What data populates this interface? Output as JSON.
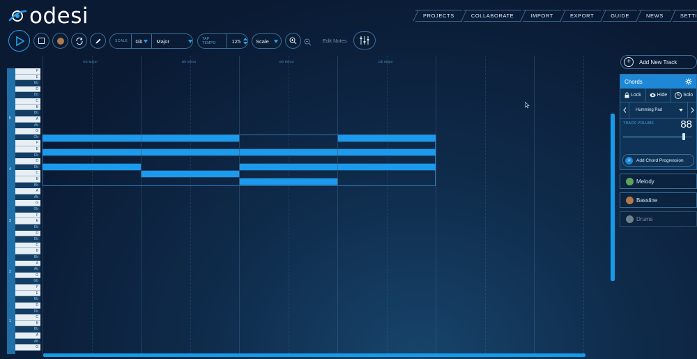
{
  "app": {
    "logo_text": "odesi"
  },
  "nav": [
    "PROJECTS",
    "COLLABORATE",
    "IMPORT",
    "EXPORT",
    "GUIDE",
    "NEWS",
    "SETTINGS"
  ],
  "toolbar": {
    "scale_label": "SCALE",
    "scale_key": "Gb",
    "scale_mode": "Major",
    "tap_tempo_label": "TAP TEMPO",
    "tempo": "125",
    "snap": "Scale",
    "edit_notes": "Edit Notes"
  },
  "chord_labels": [
    "Gb Major",
    "Bb Minor",
    "Eb Minor",
    "Db Major"
  ],
  "piano": {
    "octaves": [
      "5",
      "4",
      "3",
      "2",
      "1"
    ],
    "keys": [
      {
        "n": "F",
        "c": "w"
      },
      {
        "n": "E",
        "c": "w"
      },
      {
        "n": "Eb",
        "c": "b"
      },
      {
        "n": "D",
        "c": "w"
      },
      {
        "n": "Db",
        "c": "b"
      },
      {
        "n": "C",
        "c": "w"
      },
      {
        "n": "B",
        "c": "w"
      },
      {
        "n": "Bb",
        "c": "b"
      },
      {
        "n": "A",
        "c": "w"
      },
      {
        "n": "Ab",
        "c": "b"
      },
      {
        "n": "G",
        "c": "w"
      },
      {
        "n": "Gb",
        "c": "b"
      },
      {
        "n": "F",
        "c": "w"
      },
      {
        "n": "E",
        "c": "w"
      },
      {
        "n": "Eb",
        "c": "b"
      },
      {
        "n": "D",
        "c": "w"
      },
      {
        "n": "Db",
        "c": "b"
      },
      {
        "n": "C",
        "c": "w"
      },
      {
        "n": "B",
        "c": "w"
      },
      {
        "n": "Bb",
        "c": "b"
      },
      {
        "n": "A",
        "c": "w"
      },
      {
        "n": "Ab",
        "c": "b"
      },
      {
        "n": "G",
        "c": "w"
      },
      {
        "n": "Gb",
        "c": "b"
      },
      {
        "n": "F",
        "c": "w"
      },
      {
        "n": "E",
        "c": "w"
      },
      {
        "n": "Eb",
        "c": "b"
      },
      {
        "n": "D",
        "c": "w"
      },
      {
        "n": "Db",
        "c": "b"
      },
      {
        "n": "C",
        "c": "w"
      },
      {
        "n": "B",
        "c": "w"
      },
      {
        "n": "Bb",
        "c": "b"
      },
      {
        "n": "A",
        "c": "w"
      },
      {
        "n": "Ab",
        "c": "b"
      },
      {
        "n": "G",
        "c": "w"
      },
      {
        "n": "Gb",
        "c": "b"
      },
      {
        "n": "F",
        "c": "w"
      },
      {
        "n": "E",
        "c": "w"
      },
      {
        "n": "Eb",
        "c": "b"
      },
      {
        "n": "D",
        "c": "w"
      },
      {
        "n": "Db",
        "c": "b"
      },
      {
        "n": "C",
        "c": "w"
      },
      {
        "n": "B",
        "c": "w"
      },
      {
        "n": "Bb",
        "c": "b"
      },
      {
        "n": "A",
        "c": "w"
      },
      {
        "n": "Ab",
        "c": "b"
      },
      {
        "n": "G",
        "c": "w"
      }
    ]
  },
  "tracks_panel": {
    "add_track": "Add New Track",
    "chords": {
      "name": "Chords",
      "lock": "Lock",
      "hide": "Hide",
      "solo": "Solo",
      "instrument": "Humming Pad",
      "volume_label": "TRACK VOLUME",
      "volume": "88",
      "volume_level": 0.88,
      "add_progression": "Add Chord Progression"
    },
    "other_tracks": [
      {
        "name": "Melody",
        "color": "#5fa35a"
      },
      {
        "name": "Bassline",
        "color": "#b3784a"
      },
      {
        "name": "Drums",
        "color": "#6f7f8d"
      }
    ]
  },
  "colors": {
    "accent": "#1a9bee",
    "background": "#0b1b33",
    "chords_header": "#1e88d6"
  }
}
